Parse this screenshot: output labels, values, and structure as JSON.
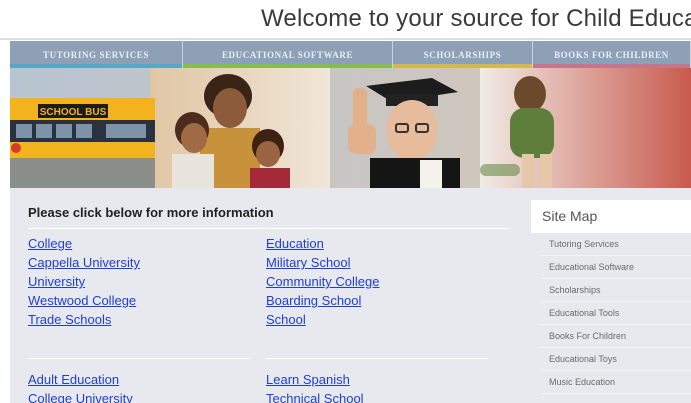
{
  "header": {
    "title": "Welcome to your source for Child Educati"
  },
  "nav": {
    "items": [
      {
        "label": "TUTORING SERVICES"
      },
      {
        "label": "EDUCATIONAL SOFTWARE"
      },
      {
        "label": "SCHOLARSHIPS"
      },
      {
        "label": "BOOKS FOR CHILDREN"
      }
    ]
  },
  "banner": {
    "bus_sign": "SCHOOL BUS"
  },
  "main": {
    "section_title": "Please click below for more information",
    "links_left": [
      "College",
      "Cappella University",
      "University",
      "Westwood College",
      "Trade Schools"
    ],
    "links_right": [
      "Education",
      "Military School",
      "Community College",
      "Boarding School",
      "School"
    ],
    "links_left_2": [
      "Adult Education",
      "College University"
    ],
    "links_right_2": [
      "Learn Spanish",
      "Technical School"
    ]
  },
  "sitemap": {
    "title": "Site Map",
    "items": [
      "Tutoring Services",
      "Educational Software",
      "Scholarships",
      "Educational Tools",
      "Books For Children",
      "Educational Toys",
      "Music Education"
    ]
  },
  "colors": {
    "link": "#1f3fd1",
    "nav_bg": "#8ea0b6",
    "panel_bg": "#e7e9ef",
    "tab_accent_1": "#58a7c8",
    "tab_accent_2": "#87bd4e",
    "tab_accent_3": "#d6b94c",
    "tab_accent_4": "#c8758c"
  }
}
